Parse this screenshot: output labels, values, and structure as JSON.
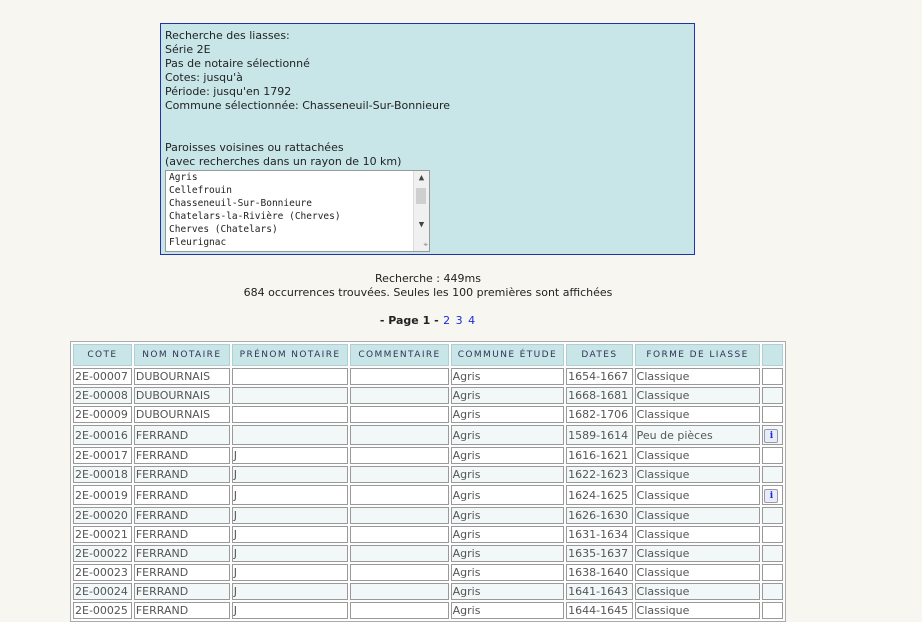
{
  "criteria": {
    "lines": [
      "Recherche des liasses:",
      "Série 2E",
      "Pas de notaire sélectionné",
      "Cotes: jusqu'à",
      "Période: jusqu'en 1792",
      "Commune sélectionnée: Chasseneuil-Sur-Bonnieure"
    ],
    "voisines_title": "Paroisses voisines ou rattachées",
    "voisines_subtitle": "(avec recherches dans un rayon de 10 km)",
    "parishes": [
      "Agris",
      "Cellefrouin",
      "Chasseneuil-Sur-Bonnieure",
      "Chatelars-la-Rivière (Cherves)",
      "Cherves (Chatelars)",
      "Fleurignac"
    ]
  },
  "search_time": "Recherche : 449ms",
  "results_summary": "684 occurrences trouvées. Seules les 100 premières sont affichées",
  "pager": {
    "prefix": "- Page 1 -",
    "pages": [
      "2",
      "3",
      "4"
    ]
  },
  "table": {
    "headers": [
      "Cote",
      "Nom notaire",
      "Prénom notaire",
      "Commentaire",
      "Commune étude",
      "Dates",
      "Forme de liasse",
      ""
    ],
    "rows": [
      {
        "cote": "2E-00007",
        "nom": "DUBOURNAIS",
        "prenom": "",
        "commentaire": "",
        "commune": "Agris",
        "dates": "1654-1667",
        "forme": "Classique",
        "info": ""
      },
      {
        "cote": "2E-00008",
        "nom": "DUBOURNAIS",
        "prenom": "",
        "commentaire": "",
        "commune": "Agris",
        "dates": "1668-1681",
        "forme": "Classique",
        "info": ""
      },
      {
        "cote": "2E-00009",
        "nom": "DUBOURNAIS",
        "prenom": "",
        "commentaire": "",
        "commune": "Agris",
        "dates": "1682-1706",
        "forme": "Classique",
        "info": ""
      },
      {
        "cote": "2E-00016",
        "nom": "FERRAND",
        "prenom": "",
        "commentaire": "",
        "commune": "Agris",
        "dates": "1589-1614",
        "forme": "Peu de pièces",
        "info": "i"
      },
      {
        "cote": "2E-00017",
        "nom": "FERRAND",
        "prenom": "J",
        "commentaire": "",
        "commune": "Agris",
        "dates": "1616-1621",
        "forme": "Classique",
        "info": ""
      },
      {
        "cote": "2E-00018",
        "nom": "FERRAND",
        "prenom": "J",
        "commentaire": "",
        "commune": "Agris",
        "dates": "1622-1623",
        "forme": "Classique",
        "info": ""
      },
      {
        "cote": "2E-00019",
        "nom": "FERRAND",
        "prenom": "J",
        "commentaire": "",
        "commune": "Agris",
        "dates": "1624-1625",
        "forme": "Classique",
        "info": "i"
      },
      {
        "cote": "2E-00020",
        "nom": "FERRAND",
        "prenom": "J",
        "commentaire": "",
        "commune": "Agris",
        "dates": "1626-1630",
        "forme": "Classique",
        "info": ""
      },
      {
        "cote": "2E-00021",
        "nom": "FERRAND",
        "prenom": "J",
        "commentaire": "",
        "commune": "Agris",
        "dates": "1631-1634",
        "forme": "Classique",
        "info": ""
      },
      {
        "cote": "2E-00022",
        "nom": "FERRAND",
        "prenom": "J",
        "commentaire": "",
        "commune": "Agris",
        "dates": "1635-1637",
        "forme": "Classique",
        "info": ""
      },
      {
        "cote": "2E-00023",
        "nom": "FERRAND",
        "prenom": "J",
        "commentaire": "",
        "commune": "Agris",
        "dates": "1638-1640",
        "forme": "Classique",
        "info": ""
      },
      {
        "cote": "2E-00024",
        "nom": "FERRAND",
        "prenom": "J",
        "commentaire": "",
        "commune": "Agris",
        "dates": "1641-1643",
        "forme": "Classique",
        "info": ""
      },
      {
        "cote": "2E-00025",
        "nom": "FERRAND",
        "prenom": "J",
        "commentaire": "",
        "commune": "Agris",
        "dates": "1644-1645",
        "forme": "Classique",
        "info": ""
      }
    ]
  }
}
